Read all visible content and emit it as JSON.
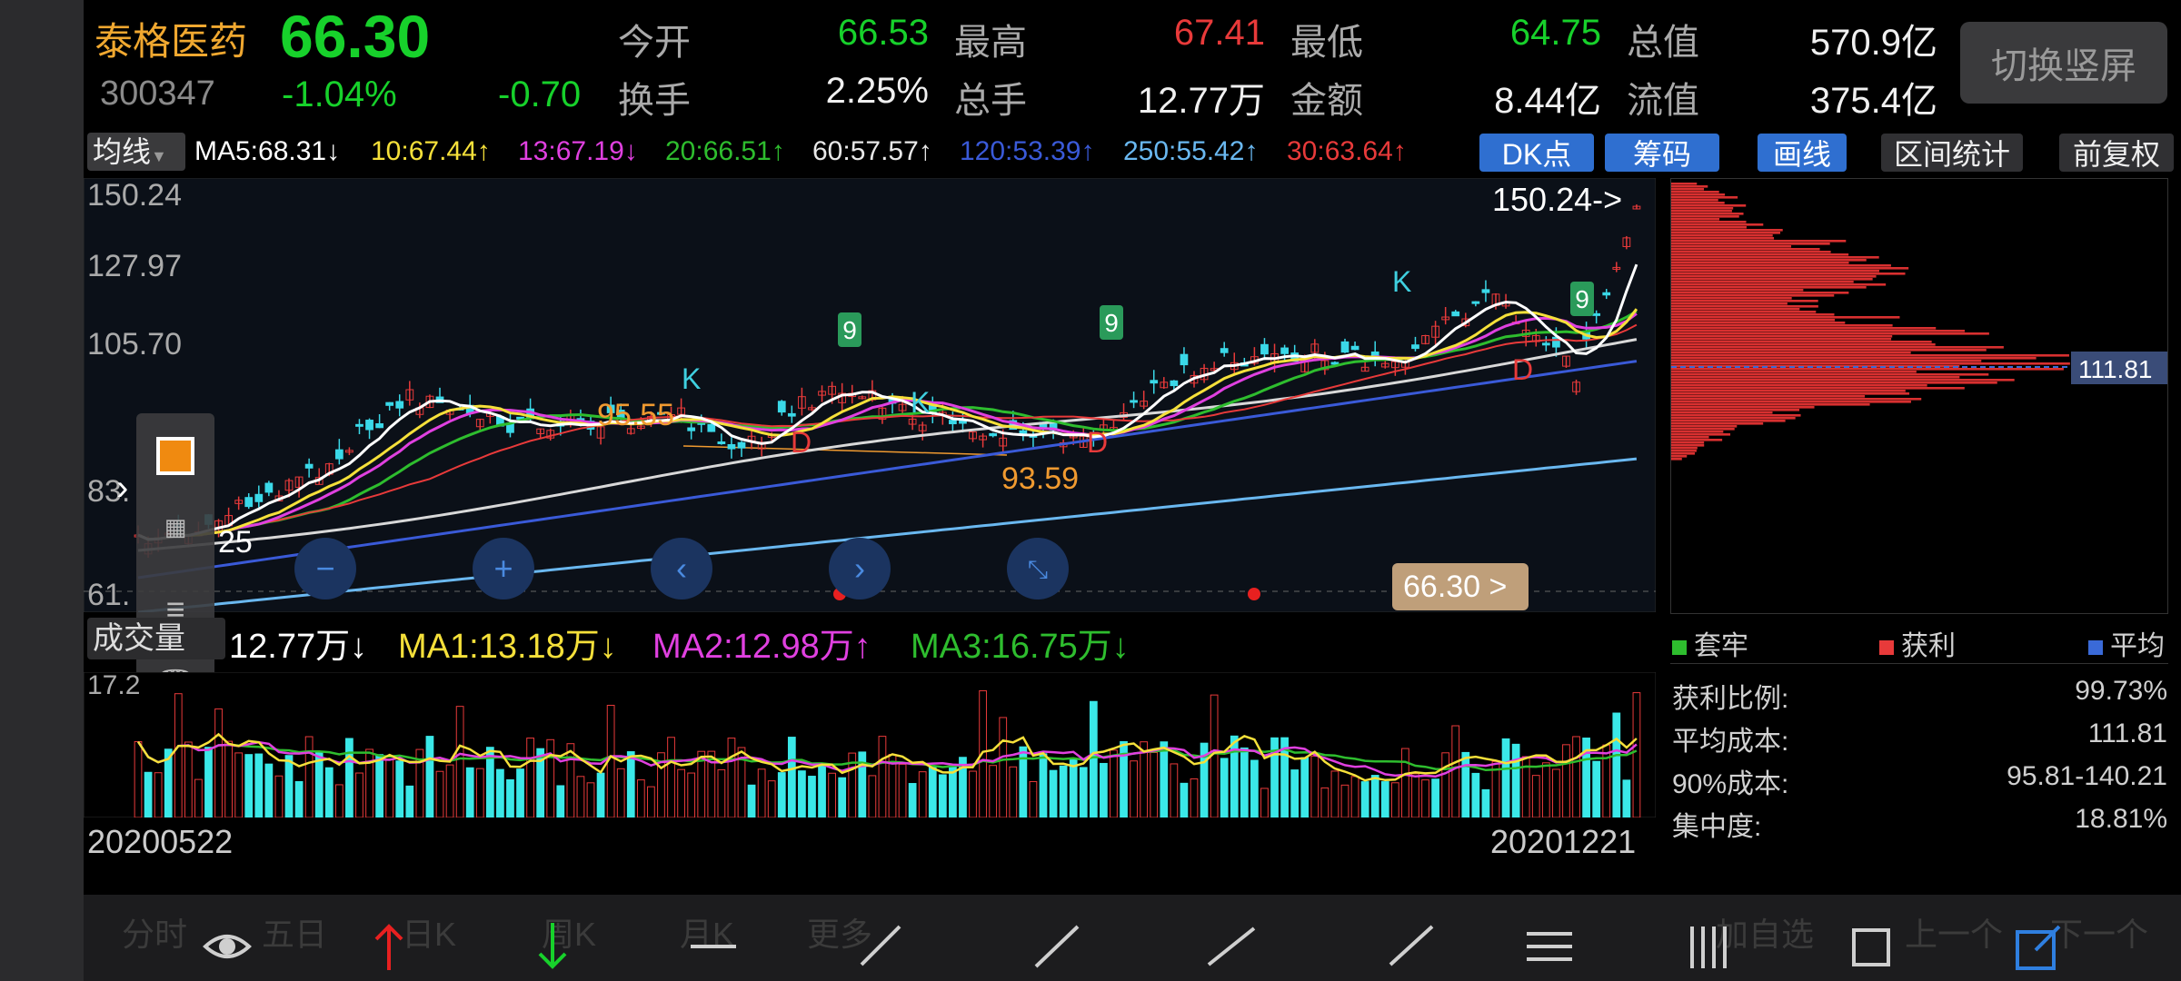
{
  "stock": {
    "name": "泰格医药",
    "price": "66.30",
    "code": "300347",
    "change_pct": "-1.04%",
    "change": "-0.70"
  },
  "quote": {
    "open_label": "今开",
    "open": "66.53",
    "high_label": "最高",
    "high": "67.41",
    "low_label": "最低",
    "low": "64.75",
    "mktcap_label": "总值",
    "mktcap": "570.9亿",
    "turnover_label": "换手",
    "turnover": "2.25%",
    "volume_label": "总手",
    "volume": "12.77万",
    "amount_label": "金额",
    "amount": "8.44亿",
    "float_label": "流值",
    "float_cap": "375.4亿"
  },
  "switch_button": "切换竖屏",
  "ma_bar": {
    "selector": "均线",
    "ma5": "MA5:68.31↓",
    "ma10": "10:67.44↑",
    "ma13": "13:67.19↓",
    "ma20": "20:66.51↑",
    "ma60": "60:57.57↑",
    "ma120": "120:53.39↑",
    "ma250": "250:55.42↑",
    "ma30": "30:63.64↑"
  },
  "tool_tags": {
    "dk": "DK点",
    "chips": "筹码",
    "draw": "画线",
    "range": "区间统计",
    "adjust": "前复权"
  },
  "axis": {
    "y1": "150.24",
    "y2": "127.97",
    "y3": "105.70",
    "y4": "83.",
    "y5": "61.",
    "date_start": "20200522",
    "date_end": "20201221"
  },
  "annotations": {
    "max_label": "150.24->",
    "low1": "95.55",
    "low2": "93.59",
    "current_price": "66.30 >",
    "left_low": "25",
    "k_marker": "K",
    "d_marker": "D",
    "nine": "9"
  },
  "chip_price": "111.81",
  "volume_bar": {
    "label": "成交量",
    "value": "12.77万↓",
    "ma1": "MA1:13.18万↓",
    "ma2": "MA2:12.98万↑",
    "ma3": "MA3:16.75万↓",
    "ymax": "17.2"
  },
  "chip_legend": {
    "trapped": "套牢",
    "profit": "获利",
    "average": "平均"
  },
  "chip_stats": [
    {
      "label": "获利比例:",
      "value": "99.73%"
    },
    {
      "label": "平均成本:",
      "value": "111.81"
    },
    {
      "label": "90%成本:",
      "value": "95.81-140.21"
    },
    {
      "label": "集中度:",
      "value": "18.81%"
    }
  ],
  "bottom_tabs": [
    "分时",
    "五日",
    "日K",
    "周K",
    "月K",
    "更多"
  ],
  "bottom_right": {
    "add": "加自选",
    "prev": "上一个",
    "next": "下一个"
  },
  "colors": {
    "up": "#e83a3a",
    "down": "#17d12b",
    "ma5": "#ffffff",
    "ma10": "#f5e03a",
    "ma13": "#e040e0",
    "ma20": "#2ebd2e",
    "ma60": "#d8d8d8",
    "ma120": "#3a5ad8",
    "ma250": "#6ab8f0",
    "ma30": "#e83a3a"
  }
}
